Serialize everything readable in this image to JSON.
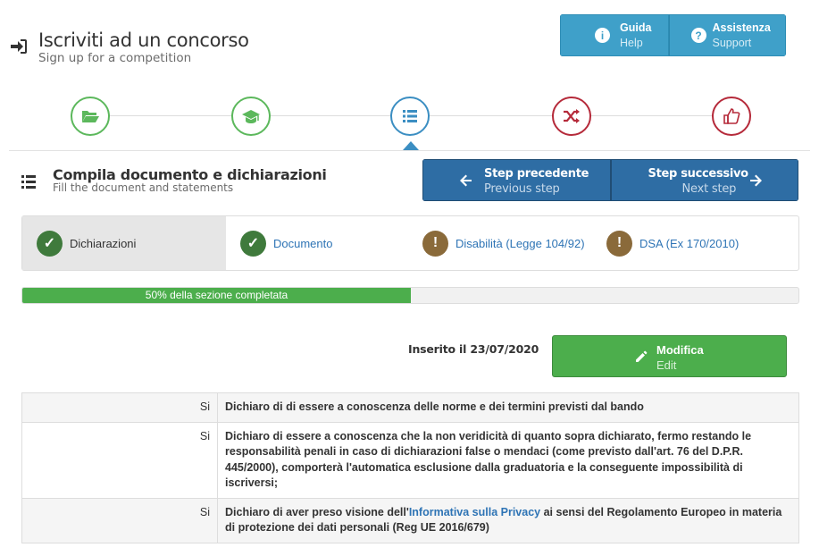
{
  "header": {
    "title": "Iscriviti ad un concorso",
    "subtitle": "Sign up for a competition"
  },
  "help_buttons": [
    {
      "main": "Guida",
      "sub": "Help",
      "icon": "info-icon"
    },
    {
      "main": "Assistenza",
      "sub": "Support",
      "icon": "question-icon"
    }
  ],
  "wizard_steps": [
    {
      "icon": "folder-open-icon",
      "status": "done"
    },
    {
      "icon": "graduation-cap-icon",
      "status": "done"
    },
    {
      "icon": "list-icon",
      "status": "current"
    },
    {
      "icon": "random-icon",
      "status": "todo"
    },
    {
      "icon": "thumbs-up-icon",
      "status": "todo"
    }
  ],
  "section": {
    "title": "Compila documento e dichiarazioni",
    "subtitle": "Fill the document and statements"
  },
  "nav": {
    "prev_main": "Step precedente",
    "prev_sub": "Previous step",
    "next_main": "Step successivo",
    "next_sub": "Next step"
  },
  "tabs": [
    {
      "label": "Dichiarazioni",
      "status": "ok",
      "active": true
    },
    {
      "label": "Documento",
      "status": "ok",
      "active": false
    },
    {
      "label": "Disabilità (Legge 104/92)",
      "status": "warn",
      "active": false
    },
    {
      "label": "DSA (Ex 170/2010)",
      "status": "warn",
      "active": false
    }
  ],
  "progress": {
    "label": "50% della sezione completata",
    "percent": 50
  },
  "inserted": "Inserito il 23/07/2020",
  "edit": {
    "main": "Modifica",
    "sub": "Edit"
  },
  "declarations": [
    {
      "answer": "Si",
      "text": "Dichiaro di di essere a conoscenza delle norme e dei termini previsti dal bando"
    },
    {
      "answer": "Si",
      "text": "Dichiaro di essere a conoscenza che la non veridicità di quanto sopra dichiarato, fermo restando le responsabilità penali in caso di dichiarazioni false o mendaci (come previsto dall'art. 76 del D.P.R. 445/2000), comporterà l'automatica esclusione dalla graduatoria e la conseguente impossibilità di iscriversi;"
    },
    {
      "answer": "Si",
      "text_before": "Dichiaro di aver preso visione dell'",
      "link": "Informativa sulla Privacy",
      "text_after": " ai sensi del Regolamento Europeo in materia di protezione dei dati personali (Reg UE 2016/679)"
    }
  ],
  "colors": {
    "help_blue": "#3fa0c9",
    "nav_blue": "#2e6da4",
    "success_green": "#4cae4c",
    "step_red": "#b52a3a",
    "link_blue": "#2e74b5"
  }
}
